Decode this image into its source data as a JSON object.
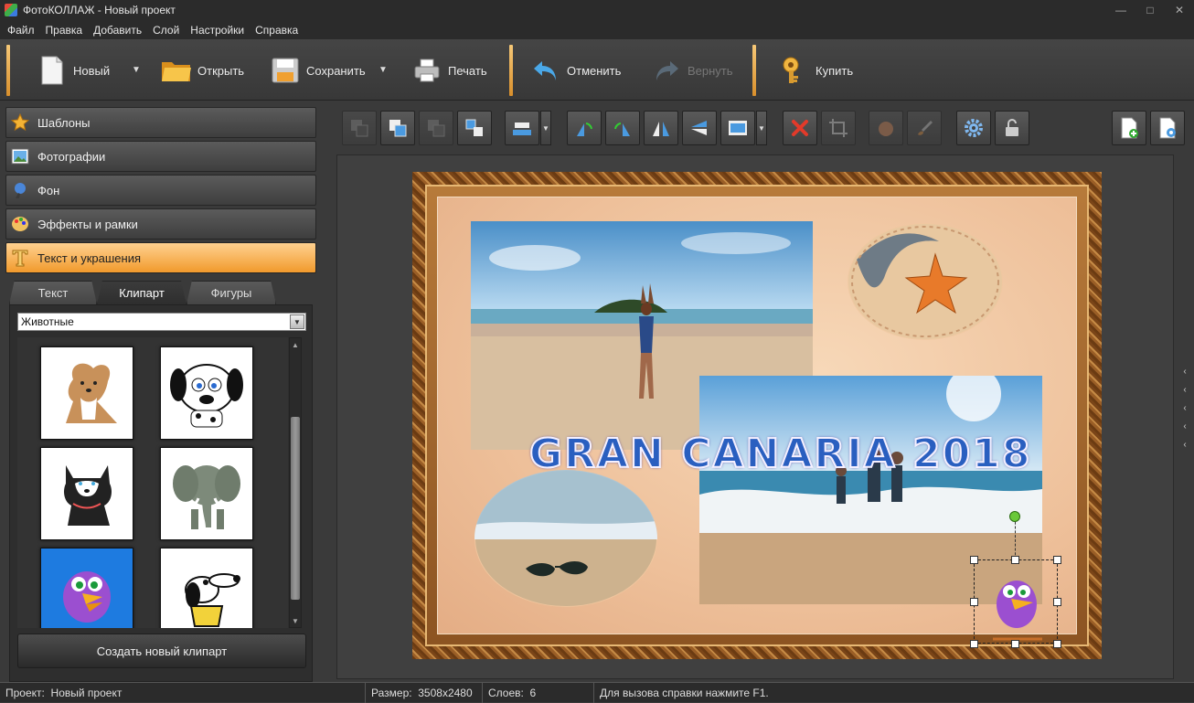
{
  "window": {
    "title": "ФотоКОЛЛАЖ - Новый проект",
    "minimize": "—",
    "maximize": "□",
    "close": "✕"
  },
  "menu": [
    "Файл",
    "Правка",
    "Добавить",
    "Слой",
    "Настройки",
    "Справка"
  ],
  "toolbar": {
    "new_label": "Новый",
    "open_label": "Открыть",
    "save_label": "Сохранить",
    "print_label": "Печать",
    "undo_label": "Отменить",
    "redo_label": "Вернуть",
    "buy_label": "Купить",
    "dropdown_glyph": "▼"
  },
  "sidebar": {
    "sections": [
      {
        "label": "Шаблоны",
        "icon": "star-icon"
      },
      {
        "label": "Фотографии",
        "icon": "photos-icon"
      },
      {
        "label": "Фон",
        "icon": "background-icon"
      },
      {
        "label": "Эффекты и рамки",
        "icon": "palette-icon"
      },
      {
        "label": "Текст и украшения",
        "icon": "text-icon",
        "active": true
      }
    ],
    "tabs": [
      {
        "label": "Текст"
      },
      {
        "label": "Клипарт",
        "active": true
      },
      {
        "label": "Фигуры"
      }
    ],
    "category_select": "Животные",
    "clipart": [
      "collie-dog",
      "dalmatian-puppy",
      "husky-puppy",
      "elephant",
      "purple-bird",
      "cartoon-dog"
    ],
    "create_clipart_label": "Создать новый клипарт"
  },
  "collage": {
    "title_text": "GRAN CANARIA 2018"
  },
  "edge_arrows": [
    "‹",
    "‹",
    "‹",
    "‹",
    "‹"
  ],
  "status": {
    "project_label": "Проект:",
    "project_value": "Новый проект",
    "size_label": "Размер:",
    "size_value": "3508x2480",
    "layers_label": "Слоев:",
    "layers_value": "6",
    "help_text": "Для вызова справки нажмите F1."
  },
  "colors": {
    "accent": "#f0a030",
    "background": "#3a3a3a",
    "delete_red": "#e23a2a"
  }
}
